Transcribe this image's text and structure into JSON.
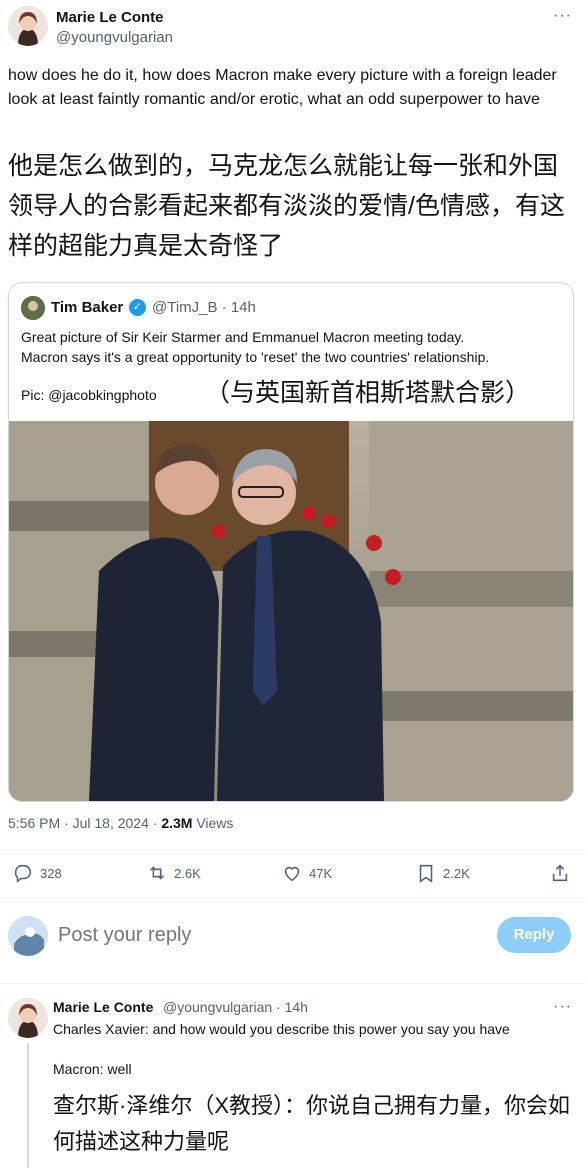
{
  "tweet": {
    "author_name": "Marie Le Conte",
    "author_handle": "@youngvulgarian",
    "text_en": "how does he do it, how does Macron make every picture with a foreign leader look at least faintly romantic and/or erotic, what an odd superpower to have",
    "text_zh": "他是怎么做到的，马克龙怎么就能让每一张和外国领导人的合影看起来都有淡淡的爱情/色情感，有这样的超能力真是太奇怪了"
  },
  "quote": {
    "author_name": "Tim Baker",
    "author_handle": "@TimJ_B · 14h",
    "line1": "Great picture of Sir Keir Starmer and Emmanuel Macron meeting today.",
    "line2": "Macron says it's a great opportunity to 'reset' the two countries' relationship.",
    "pic_credit": "Pic: @jacobkingphoto",
    "caption_zh": "（与英国新首相斯塔默合影）"
  },
  "meta": {
    "time_date": "5:56 PM · Jul 18, 2024 · ",
    "views_count": "2.3M",
    "views_label": " Views"
  },
  "actions": {
    "replies": "328",
    "reposts": "2.6K",
    "likes": "47K",
    "bookmarks": "2.2K"
  },
  "reply_box": {
    "placeholder": "Post your reply",
    "button": "Reply"
  },
  "reply": {
    "author_name": "Marie Le Conte",
    "author_handle": "@youngvulgarian · 14h",
    "line1": "Charles Xavier: and how would you describe this power you say you have",
    "line2": "Macron: well",
    "text_zh": "查尔斯·泽维尔（X教授）：你说自己拥有力量，你会如何描述这种力量呢"
  },
  "colors": {
    "accent": "#1d9bf0",
    "muted": "#536471",
    "border": "#cfd9de"
  }
}
